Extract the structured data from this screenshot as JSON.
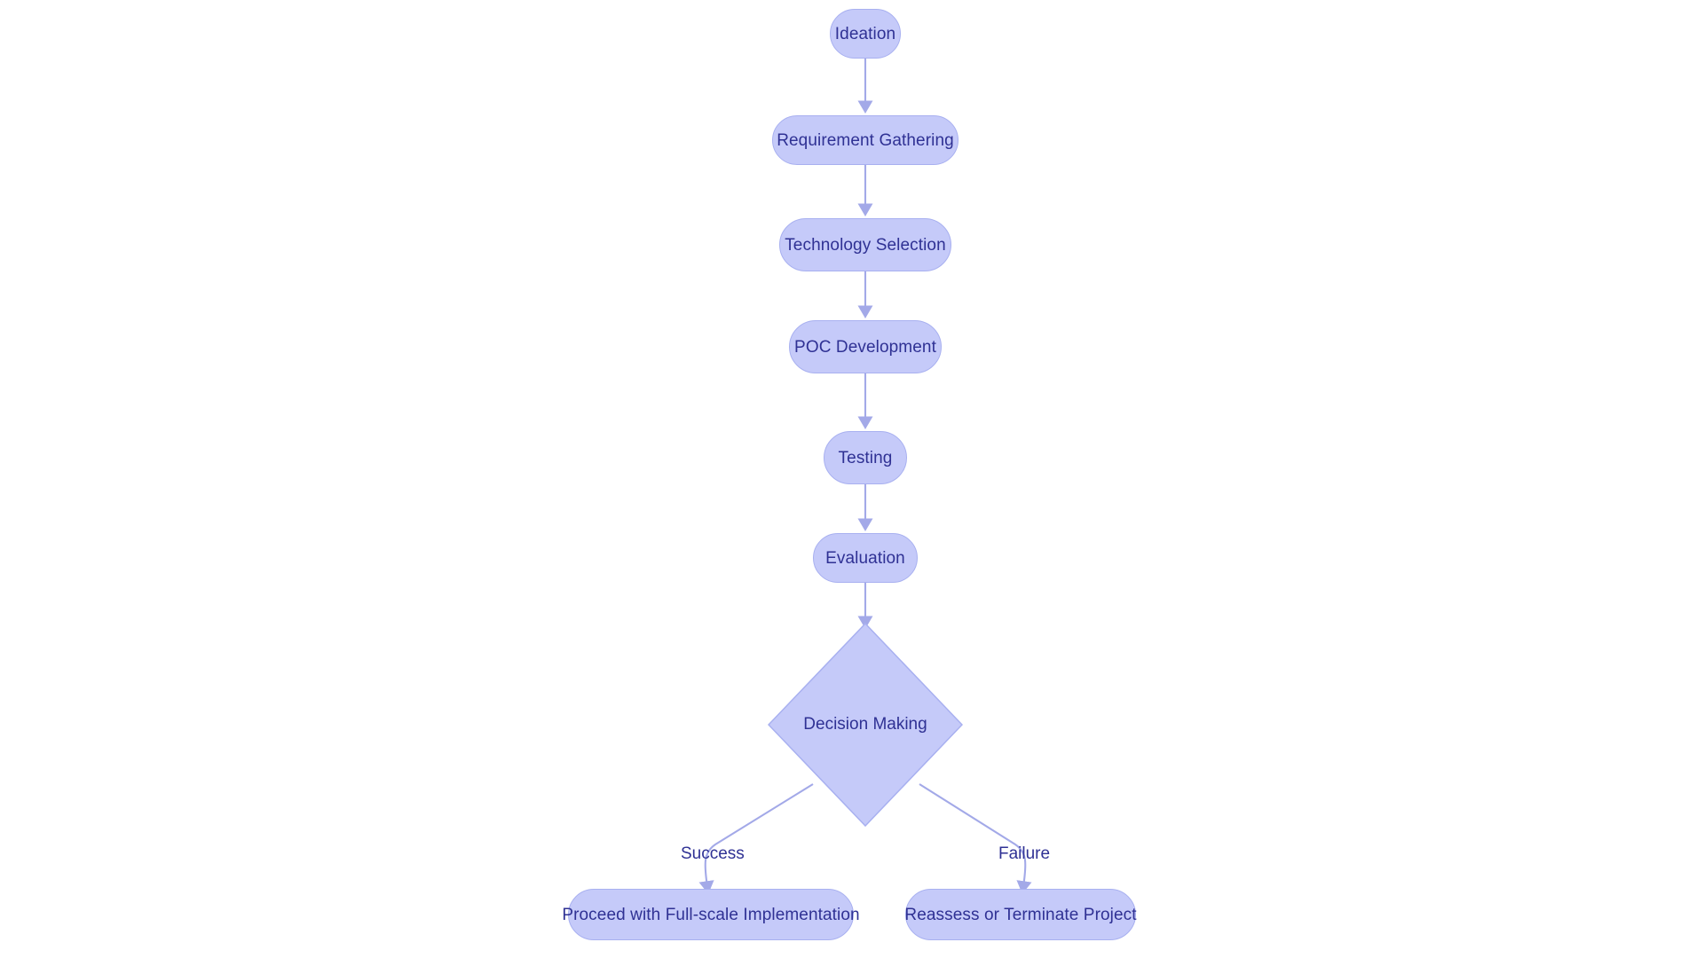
{
  "diagram": {
    "type": "flowchart",
    "orientation": "top-to-bottom",
    "background_color": "#ffffff",
    "node_fill": "#c5caf9",
    "node_border": "#a8b0f0",
    "node_text_color": "#2f3194",
    "edge_color": "#a3a9e8"
  },
  "nodes": [
    {
      "id": "ideation",
      "label": "Ideation",
      "shape": "rounded-pill"
    },
    {
      "id": "requirements",
      "label": "Requirement Gathering",
      "shape": "rounded-pill"
    },
    {
      "id": "technology",
      "label": "Technology Selection",
      "shape": "rounded-pill"
    },
    {
      "id": "poc",
      "label": "POC Development",
      "shape": "rounded-pill"
    },
    {
      "id": "testing",
      "label": "Testing",
      "shape": "rounded-pill"
    },
    {
      "id": "evaluation",
      "label": "Evaluation",
      "shape": "rounded-pill"
    },
    {
      "id": "decision",
      "label": "Decision Making",
      "shape": "diamond"
    },
    {
      "id": "proceed",
      "label": "Proceed with Full-scale Implementation",
      "shape": "rounded-pill"
    },
    {
      "id": "reassess",
      "label": "Reassess or Terminate Project",
      "shape": "rounded-pill"
    }
  ],
  "edges": [
    {
      "from": "ideation",
      "to": "requirements",
      "label": ""
    },
    {
      "from": "requirements",
      "to": "technology",
      "label": ""
    },
    {
      "from": "technology",
      "to": "poc",
      "label": ""
    },
    {
      "from": "poc",
      "to": "testing",
      "label": ""
    },
    {
      "from": "testing",
      "to": "evaluation",
      "label": ""
    },
    {
      "from": "evaluation",
      "to": "decision",
      "label": ""
    },
    {
      "from": "decision",
      "to": "proceed",
      "label": "Success"
    },
    {
      "from": "decision",
      "to": "reassess",
      "label": "Failure"
    }
  ],
  "edge_labels": {
    "success": "Success",
    "failure": "Failure"
  }
}
